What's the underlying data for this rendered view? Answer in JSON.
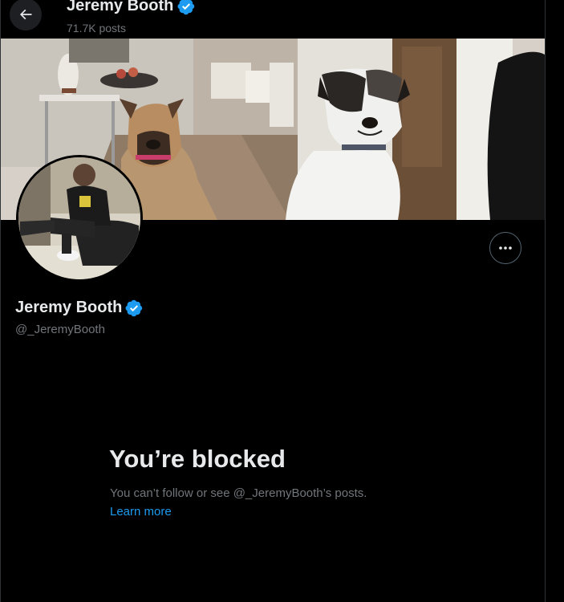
{
  "header": {
    "name": "Jeremy Booth",
    "posts_count": "71.7K posts"
  },
  "profile": {
    "display_name": "Jeremy Booth",
    "handle": "@_JeremyBooth",
    "verified": true
  },
  "blocked": {
    "title": "You’re blocked",
    "description": "You can’t follow or see @_JeremyBooth’s posts.",
    "learn_more": "Learn more"
  },
  "colors": {
    "background": "#000000",
    "accent": "#1d9bf0",
    "muted_text": "#71767b",
    "primary_text": "#e7e9ea"
  },
  "icons": {
    "back": "arrow-left-icon",
    "verified": "verified-badge-icon",
    "more": "more-dots-icon"
  }
}
